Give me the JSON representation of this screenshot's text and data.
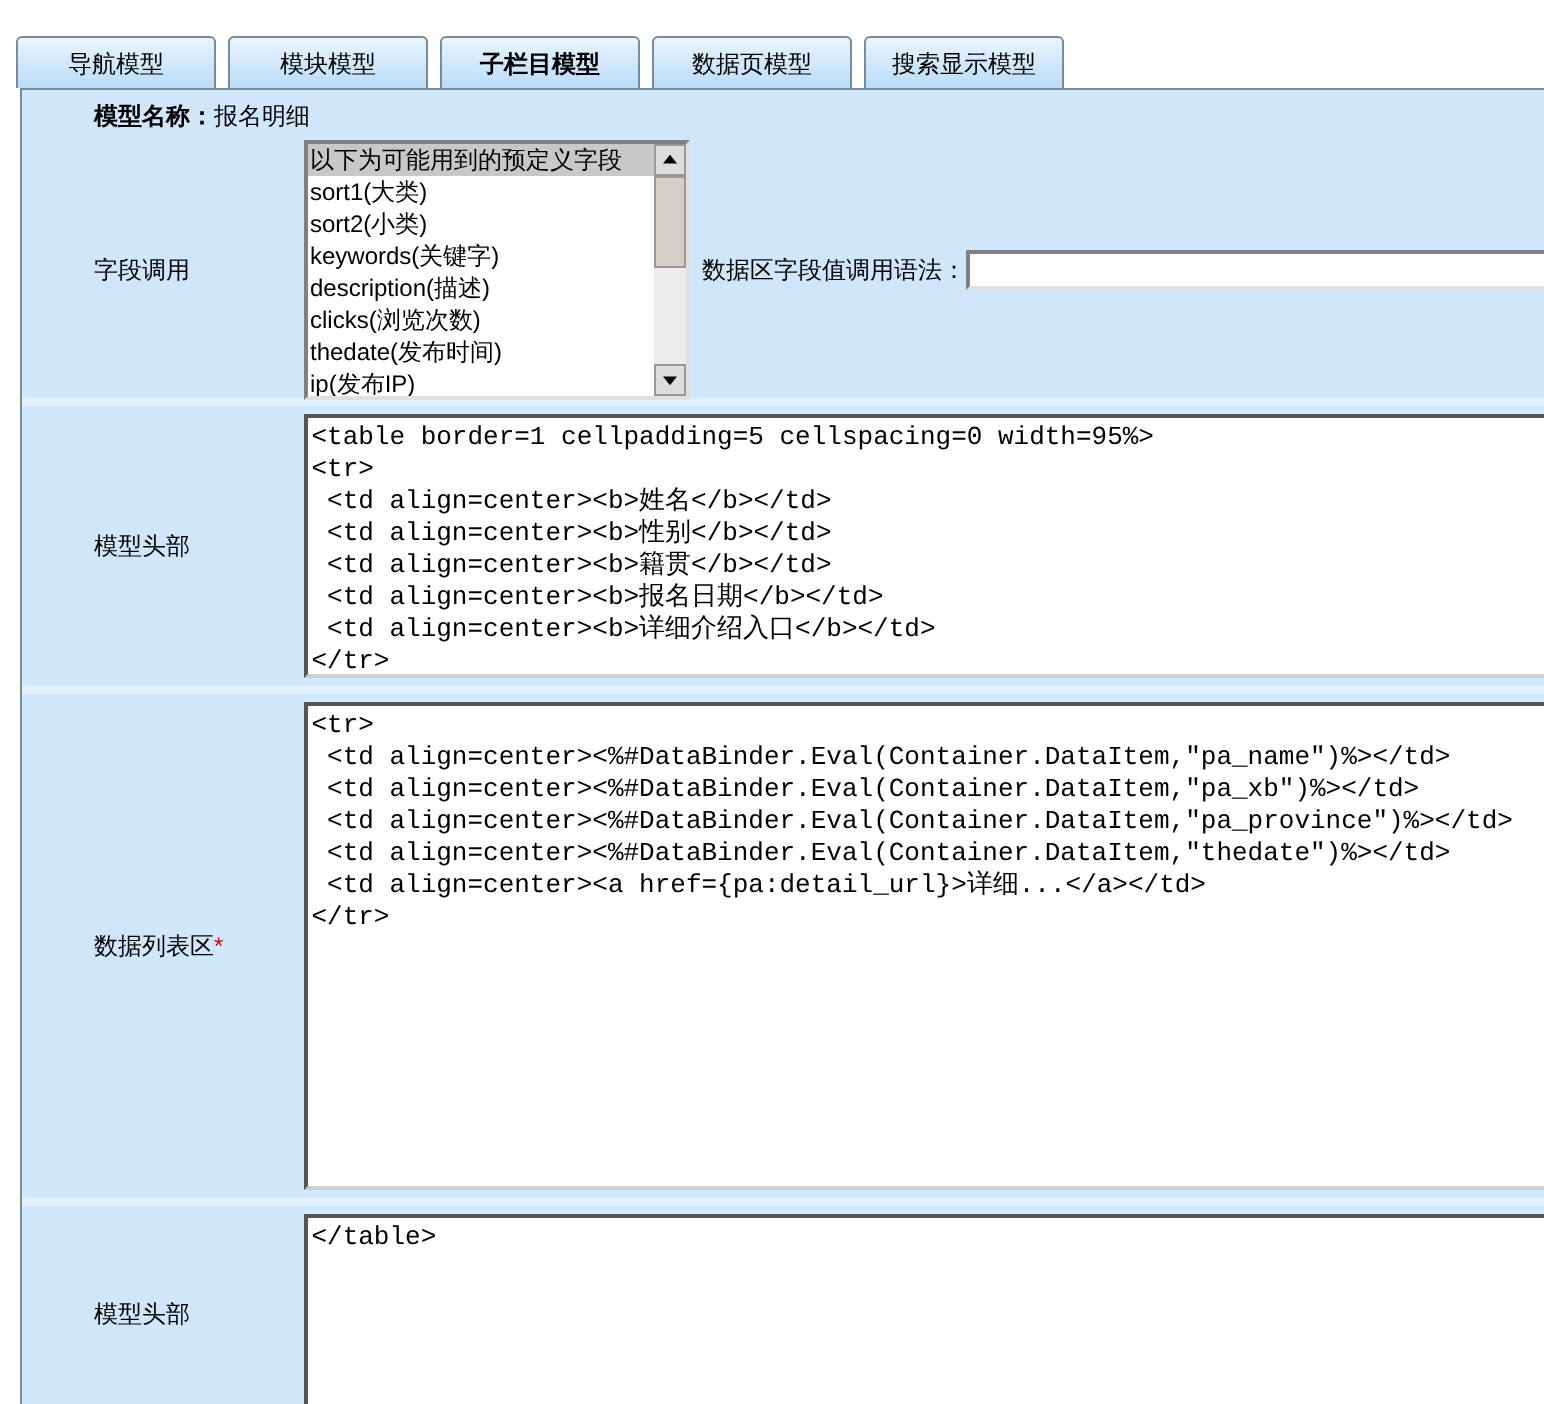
{
  "tabs": [
    {
      "label": "导航模型",
      "selected": false
    },
    {
      "label": "模块模型",
      "selected": false
    },
    {
      "label": "子栏目模型",
      "selected": true
    },
    {
      "label": "数据页模型",
      "selected": false
    },
    {
      "label": "搜索显示模型",
      "selected": false
    }
  ],
  "model_name": {
    "label": "模型名称：",
    "value": "报名明细"
  },
  "field_call": {
    "label": "字段调用",
    "options": [
      {
        "label": "以下为可能用到的预定义字段",
        "selected": true
      },
      {
        "label": "sort1(大类)",
        "selected": false
      },
      {
        "label": "sort2(小类)",
        "selected": false
      },
      {
        "label": "keywords(关键字)",
        "selected": false
      },
      {
        "label": "description(描述)",
        "selected": false
      },
      {
        "label": "clicks(浏览次数)",
        "selected": false
      },
      {
        "label": "thedate(发布时间)",
        "selected": false
      },
      {
        "label": "ip(发布IP)",
        "selected": false
      }
    ],
    "syntax_label": "数据区字段值调用语法："
  },
  "sections": [
    {
      "label": "模型头部",
      "lines": [
        "<table border=1 cellpadding=5 cellspacing=0 width=95%>",
        "<tr>",
        " <td align=center><b>姓名</b></td>",
        " <td align=center><b>性别</b></td>",
        " <td align=center><b>籍贯</b></td>",
        " <td align=center><b>报名日期</b></td>",
        " <td align=center><b>详细介绍入口</b></td>",
        "</tr>"
      ]
    },
    {
      "label": "数据列表区",
      "required_mark": "*",
      "lines": [
        "<tr>",
        " <td align=center><%#DataBinder.Eval(Container.DataItem,\"pa_name\")%></td>",
        " <td align=center><%#DataBinder.Eval(Container.DataItem,\"pa_xb\")%></td>",
        " <td align=center><%#DataBinder.Eval(Container.DataItem,\"pa_province\")%></td>",
        " <td align=center><%#DataBinder.Eval(Container.DataItem,\"thedate\")%></td>",
        " <td align=center><a href={pa:detail_url}>详细...</a></td>",
        "</tr>"
      ]
    },
    {
      "label": "模型头部",
      "lines": [
        "</table>"
      ]
    }
  ]
}
